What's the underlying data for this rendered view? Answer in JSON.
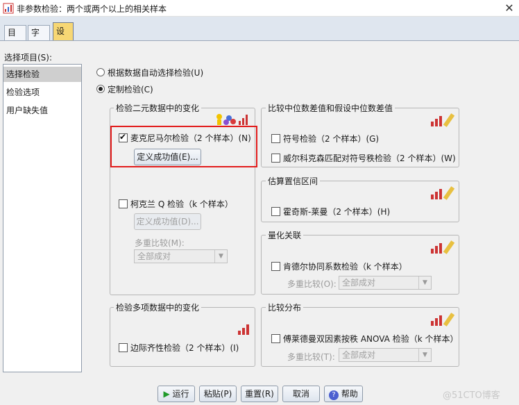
{
  "window": {
    "title": "非参数检验：两个或两个以上的相关样本",
    "close_glyph": "✕"
  },
  "tabs": [
    {
      "label": "目标"
    },
    {
      "label": "字段"
    },
    {
      "label": "设置"
    }
  ],
  "list": {
    "label": "选择项目(S):",
    "items": [
      "选择检验",
      "检验选项",
      "用户缺失值"
    ]
  },
  "options": {
    "auto": "根据数据自动选择检验(U)",
    "custom": "定制检验(C)"
  },
  "groups": {
    "binary": {
      "title": "检验二元数据中的变化",
      "mcnemar": "麦克尼马尔检验（2 个样本）(N)",
      "define_success": "定义成功值(E)...",
      "cochran": "柯克兰 Q 检验（k 个样本）",
      "define_success2": "定义成功值(D)...",
      "multi_label": "多重比较(M):",
      "multi_value": "全部成对"
    },
    "median": {
      "title": "比较中位数差值和假设中位数差值",
      "sign": "符号检验（2 个样本）(G)",
      "wilcoxon": "威尔科克森匹配对符号秩检验（2 个样本）(W)"
    },
    "ci": {
      "title": "估算置信区间",
      "hodges": "霍奇斯-莱曼（2 个样本）(H)"
    },
    "assoc": {
      "title": "量化关联",
      "kendall": "肯德尔协同系数检验（k 个样本）",
      "multi_label": "多重比较(O):",
      "multi_value": "全部成对"
    },
    "multi": {
      "title": "检验多项数据中的变化",
      "marginal": "边际齐性检验（2 个样本）(I)"
    },
    "dist": {
      "title": "比较分布",
      "friedman": "傅莱德曼双因素按秩 ANOVA 检验（k 个样本）",
      "multi_label": "多重比较(T):",
      "multi_value": "全部成对"
    }
  },
  "buttons": {
    "run": "运行",
    "paste": "粘贴(P)",
    "reset": "重置(R)",
    "cancel": "取消",
    "help": "帮助"
  },
  "watermark": "@51CTO博客",
  "colors": {
    "highlight": "#e21b1b",
    "active_tab": "#f7d774"
  }
}
